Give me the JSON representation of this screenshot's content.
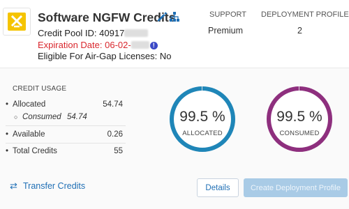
{
  "header": {
    "title": "Software NGFW Credits",
    "pool_label": "Credit Pool ID: 40917",
    "expiration_label": "Expiration Date: 06-02-",
    "airgap_label": "Eligible For Air-Gap Licenses: No",
    "support_label": "SUPPORT",
    "support_value": "Premium",
    "profiles_label": "DEPLOYMENT PROFILES",
    "profiles_value": "2"
  },
  "colors": {
    "expiration": "#d9262c",
    "allocated_ring": "#1f86b8",
    "consumed_ring": "#8e2f7e",
    "link": "#1f6fb5",
    "logo_yellow": "#f5c400"
  },
  "icons": {
    "logo": "logo-icon",
    "edit": "pencil-icon",
    "hierarchy": "hierarchy-icon",
    "warning": "info-icon",
    "transfer": "transfer-arrows-icon"
  },
  "usage": {
    "title": "CREDIT USAGE",
    "allocated_label": "Allocated",
    "allocated_value": "54.74",
    "consumed_label": "Consumed",
    "consumed_value": "54.74",
    "available_label": "Available",
    "available_value": "0.26",
    "total_label": "Total Credits",
    "total_value": "55"
  },
  "rings": {
    "allocated_pct": "99.5 %",
    "allocated_caption": "ALLOCATED",
    "allocated_fraction": 0.995,
    "consumed_pct": "99.5 %",
    "consumed_caption": "CONSUMED",
    "consumed_fraction": 0.995
  },
  "actions": {
    "transfer_label": "Transfer Credits",
    "details_label": "Details",
    "create_label": "Create Deployment Profile"
  }
}
